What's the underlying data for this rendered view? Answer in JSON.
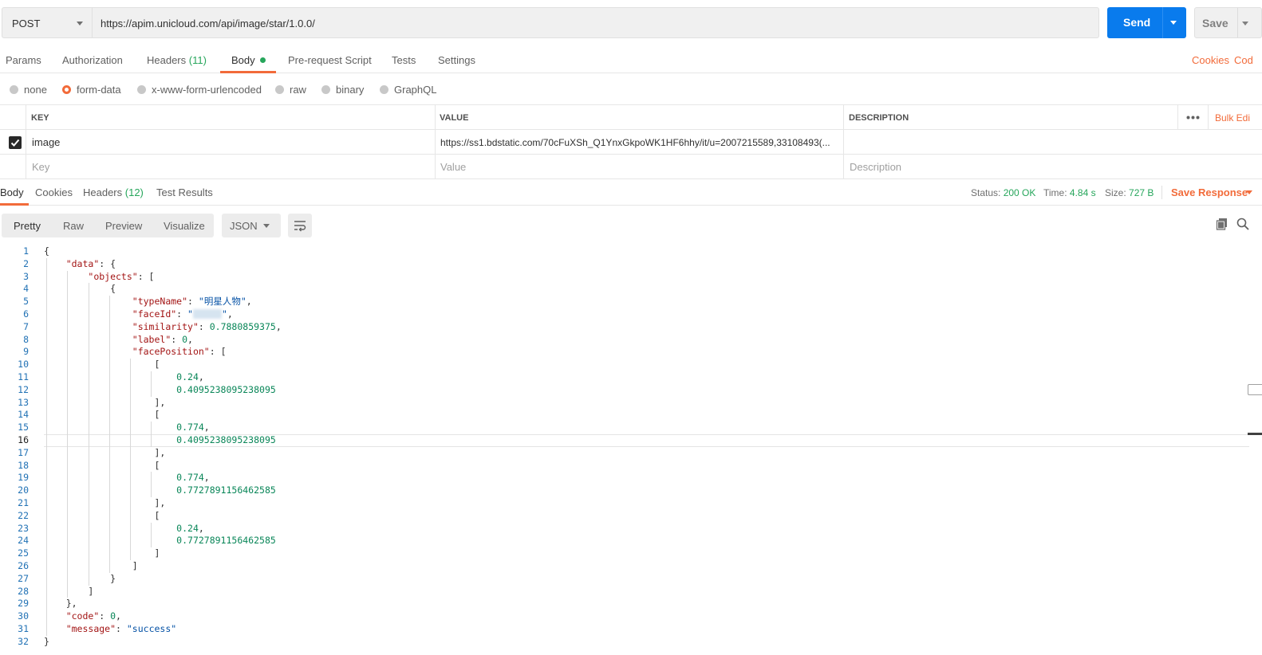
{
  "request": {
    "method": "POST",
    "url": "https://apim.unicloud.com/api/image/star/1.0.0/",
    "send_label": "Send",
    "save_label": "Save"
  },
  "request_tabs": [
    {
      "label": "Params"
    },
    {
      "label": "Authorization"
    },
    {
      "label": "Headers",
      "count": "(11)"
    },
    {
      "label": "Body",
      "active": true,
      "indicator": "green-dot"
    },
    {
      "label": "Pre-request Script"
    },
    {
      "label": "Tests"
    },
    {
      "label": "Settings"
    }
  ],
  "request_links": {
    "cookies": "Cookies",
    "code": "Cod"
  },
  "body_types": [
    {
      "label": "none",
      "selected": false
    },
    {
      "label": "form-data",
      "selected": true
    },
    {
      "label": "x-www-form-urlencoded",
      "selected": false
    },
    {
      "label": "raw",
      "selected": false
    },
    {
      "label": "binary",
      "selected": false
    },
    {
      "label": "GraphQL",
      "selected": false
    }
  ],
  "params_table": {
    "headers": {
      "key": "KEY",
      "value": "VALUE",
      "description": "DESCRIPTION",
      "bulk_edit": "Bulk Edi"
    },
    "rows": [
      {
        "checked": true,
        "key": "image",
        "value": "https://ss1.bdstatic.com/70cFuXSh_Q1YnxGkpoWK1HF6hhy/it/u=2007215589,33108493(...",
        "description": ""
      }
    ],
    "placeholders": {
      "key": "Key",
      "value": "Value",
      "description": "Description"
    }
  },
  "response_tabs": [
    {
      "label": "Body",
      "active": true
    },
    {
      "label": "Cookies"
    },
    {
      "label": "Headers",
      "count": "(12)"
    },
    {
      "label": "Test Results"
    }
  ],
  "response_meta": {
    "status_label": "Status:",
    "status": "200 OK",
    "time_label": "Time:",
    "time": "4.84 s",
    "size_label": "Size:",
    "size": "727 B",
    "save_response": "Save Response"
  },
  "view_modes": [
    {
      "label": "Pretty",
      "active": true
    },
    {
      "label": "Raw"
    },
    {
      "label": "Preview"
    },
    {
      "label": "Visualize"
    }
  ],
  "format": "JSON",
  "editor": {
    "current_line": 16,
    "line_count": 32,
    "lines": [
      [
        [
          "p",
          "{"
        ]
      ],
      [
        [
          "p",
          "    "
        ],
        [
          "k",
          "\"data\""
        ],
        [
          "p",
          ": {"
        ]
      ],
      [
        [
          "p",
          "        "
        ],
        [
          "k",
          "\"objects\""
        ],
        [
          "p",
          ": ["
        ]
      ],
      [
        [
          "p",
          "            {"
        ]
      ],
      [
        [
          "p",
          "                "
        ],
        [
          "k",
          "\"typeName\""
        ],
        [
          "p",
          ": "
        ],
        [
          "s",
          "\"明星人物\""
        ],
        [
          "p",
          ","
        ]
      ],
      [
        [
          "p",
          "                "
        ],
        [
          "k",
          "\"faceId\""
        ],
        [
          "p",
          ": "
        ],
        [
          "s",
          "\"\""
        ],
        [
          "p",
          ","
        ]
      ],
      [
        [
          "p",
          "                "
        ],
        [
          "k",
          "\"similarity\""
        ],
        [
          "p",
          ": "
        ],
        [
          "n",
          "0.7880859375"
        ],
        [
          "p",
          ","
        ]
      ],
      [
        [
          "p",
          "                "
        ],
        [
          "k",
          "\"label\""
        ],
        [
          "p",
          ": "
        ],
        [
          "n",
          "0"
        ],
        [
          "p",
          ","
        ]
      ],
      [
        [
          "p",
          "                "
        ],
        [
          "k",
          "\"facePosition\""
        ],
        [
          "p",
          ": ["
        ]
      ],
      [
        [
          "p",
          "                    ["
        ]
      ],
      [
        [
          "p",
          "                        "
        ],
        [
          "n",
          "0.24"
        ],
        [
          "p",
          ","
        ]
      ],
      [
        [
          "p",
          "                        "
        ],
        [
          "n",
          "0.4095238095238095"
        ]
      ],
      [
        [
          "p",
          "                    ],"
        ]
      ],
      [
        [
          "p",
          "                    ["
        ]
      ],
      [
        [
          "p",
          "                        "
        ],
        [
          "n",
          "0.774"
        ],
        [
          "p",
          ","
        ]
      ],
      [
        [
          "p",
          "                        "
        ],
        [
          "n",
          "0.4095238095238095"
        ]
      ],
      [
        [
          "p",
          "                    ],"
        ]
      ],
      [
        [
          "p",
          "                    ["
        ]
      ],
      [
        [
          "p",
          "                        "
        ],
        [
          "n",
          "0.774"
        ],
        [
          "p",
          ","
        ]
      ],
      [
        [
          "p",
          "                        "
        ],
        [
          "n",
          "0.7727891156462585"
        ]
      ],
      [
        [
          "p",
          "                    ],"
        ]
      ],
      [
        [
          "p",
          "                    ["
        ]
      ],
      [
        [
          "p",
          "                        "
        ],
        [
          "n",
          "0.24"
        ],
        [
          "p",
          ","
        ]
      ],
      [
        [
          "p",
          "                        "
        ],
        [
          "n",
          "0.7727891156462585"
        ]
      ],
      [
        [
          "p",
          "                    ]"
        ]
      ],
      [
        [
          "p",
          "                ]"
        ]
      ],
      [
        [
          "p",
          "            }"
        ]
      ],
      [
        [
          "p",
          "        ]"
        ]
      ],
      [
        [
          "p",
          "    },"
        ]
      ],
      [
        [
          "p",
          "    "
        ],
        [
          "k",
          "\"code\""
        ],
        [
          "p",
          ": "
        ],
        [
          "n",
          "0"
        ],
        [
          "p",
          ","
        ]
      ],
      [
        [
          "p",
          "    "
        ],
        [
          "k",
          "\"message\""
        ],
        [
          "p",
          ": "
        ],
        [
          "s",
          "\"success\""
        ]
      ],
      [
        [
          "p",
          "}"
        ]
      ]
    ]
  },
  "colors": {
    "accent": "#f26b3a",
    "send": "#097bed",
    "success": "#26a65b",
    "json_key": "#a31515",
    "json_string": "#0451a5",
    "json_number": "#098658"
  }
}
